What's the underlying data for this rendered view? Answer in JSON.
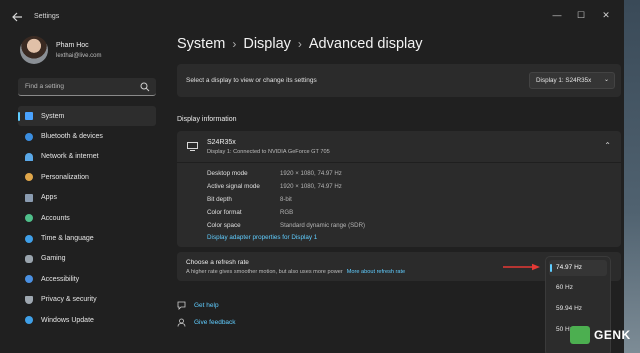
{
  "window": {
    "title": "Settings",
    "controls": {
      "minimize": "—",
      "maximize": "☐",
      "close": "✕"
    }
  },
  "user": {
    "name": "Pham Hoc",
    "email": "lexthai@live.com"
  },
  "search": {
    "placeholder": "Find a setting"
  },
  "sidebar": {
    "items": [
      {
        "label": "System",
        "icon": "system-icon",
        "color": "#4aa3ff",
        "active": true
      },
      {
        "label": "Bluetooth & devices",
        "icon": "bluetooth-icon",
        "color": "#3b8ee0"
      },
      {
        "label": "Network & internet",
        "icon": "wifi-icon",
        "color": "#5aa8e8"
      },
      {
        "label": "Personalization",
        "icon": "brush-icon",
        "color": "#e0a64a"
      },
      {
        "label": "Apps",
        "icon": "apps-icon",
        "color": "#8a9bb0"
      },
      {
        "label": "Accounts",
        "icon": "person-icon",
        "color": "#4fbf8a"
      },
      {
        "label": "Time & language",
        "icon": "globe-clock-icon",
        "color": "#3f9fe8"
      },
      {
        "label": "Gaming",
        "icon": "gamepad-icon",
        "color": "#9aa4ad"
      },
      {
        "label": "Accessibility",
        "icon": "accessibility-icon",
        "color": "#4a90e2"
      },
      {
        "label": "Privacy & security",
        "icon": "shield-icon",
        "color": "#9ea7b0"
      },
      {
        "label": "Windows Update",
        "icon": "update-icon",
        "color": "#3fa0e8"
      }
    ]
  },
  "breadcrumb": {
    "first": "System",
    "second": "Display",
    "current": "Advanced display",
    "sep": "›"
  },
  "display_select": {
    "label": "Select a display to view or change its settings",
    "value": "Display 1: S24R35x"
  },
  "display_info": {
    "section_title": "Display information",
    "monitor_name": "S24R35x",
    "monitor_sub": "Display 1: Connected to NVIDIA GeForce GT 705",
    "props": [
      {
        "label": "Desktop mode",
        "value": "1920 × 1080, 74.97 Hz"
      },
      {
        "label": "Active signal mode",
        "value": "1920 × 1080, 74.97 Hz"
      },
      {
        "label": "Bit depth",
        "value": "8-bit"
      },
      {
        "label": "Color format",
        "value": "RGB"
      },
      {
        "label": "Color space",
        "value": "Standard dynamic range (SDR)"
      }
    ],
    "adapter_link": "Display adapter properties for Display 1"
  },
  "refresh": {
    "title": "Choose a refresh rate",
    "desc": "A higher rate gives smoother motion, but also uses more power",
    "link": "More about refresh rate",
    "options": [
      "74.97 Hz",
      "60 Hz",
      "59.94 Hz",
      "50 Hz"
    ],
    "selected": "74.97 Hz"
  },
  "help": {
    "get_help": "Get help",
    "feedback": "Give feedback"
  },
  "watermark": {
    "text": "GENK"
  }
}
